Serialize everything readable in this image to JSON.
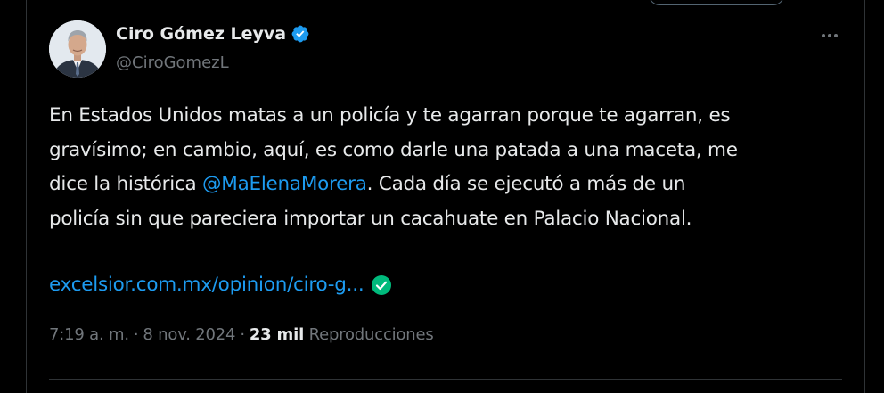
{
  "author": {
    "display_name": "Ciro Gómez Leyva",
    "handle": "@CiroGomezL",
    "verified": true,
    "verified_color": "#1d9bf0"
  },
  "tweet": {
    "lines": [
      {
        "text": "En Estados Unidos matas a un policía y te agarran porque te agarran, es"
      },
      {
        "text": "gravísimo; en cambio, aquí, es como darle una patada a una maceta, me"
      },
      {
        "before": "dice la histórica ",
        "mention": "@MaElenaMorera",
        "after": ". Cada día se ejecutó a más de un"
      },
      {
        "text": "policía sin que pareciera importar un cacahuate en Palacio Nacional."
      }
    ],
    "link_text": "excelsior.com.mx/opinion/ciro-g...",
    "link_check_color": "#00ba7c"
  },
  "meta": {
    "time": "7:19 a. m.",
    "separator": "·",
    "date": "8 nov. 2024",
    "views_count": "23 mil",
    "views_label": "Reproducciones"
  },
  "icons": {
    "more": "more-horizontal-icon",
    "verified": "verified-badge-icon",
    "link_check": "check-circle-icon"
  },
  "colors": {
    "background": "#000000",
    "text": "#e7e9ea",
    "secondary": "#71767b",
    "link": "#1d9bf0",
    "border": "#2f3336"
  }
}
